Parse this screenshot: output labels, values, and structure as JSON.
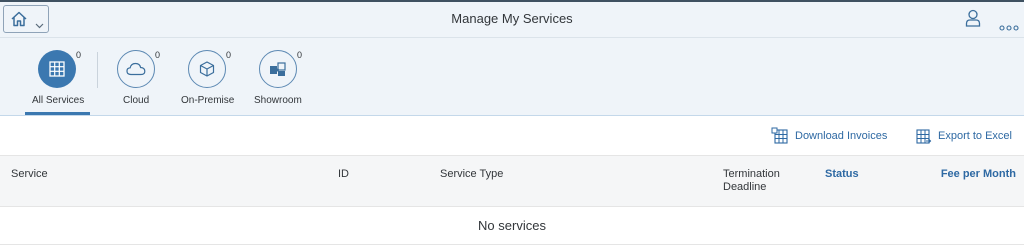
{
  "shell": {
    "title": "Manage My Services"
  },
  "tabs": [
    {
      "label": "All Services",
      "count": "0",
      "icon": "grid-icon",
      "selected": true
    },
    {
      "label": "Cloud",
      "count": "0",
      "icon": "cloud-icon",
      "selected": false
    },
    {
      "label": "On-Premise",
      "count": "0",
      "icon": "box-icon",
      "selected": false
    },
    {
      "label": "Showroom",
      "count": "0",
      "icon": "puzzle-icon",
      "selected": false
    }
  ],
  "toolbar": {
    "download_invoices": "Download Invoices",
    "export_excel": "Export to Excel"
  },
  "table": {
    "columns": {
      "service": "Service",
      "id": "ID",
      "service_type": "Service Type",
      "termination_line1": "Termination",
      "termination_line2": "Deadline",
      "status": "Status",
      "fee": "Fee per Month"
    },
    "no_data": "No services"
  },
  "colors": {
    "accent": "#3b78b0",
    "shell_bg": "#eff4f9",
    "link": "#2e69a3"
  }
}
